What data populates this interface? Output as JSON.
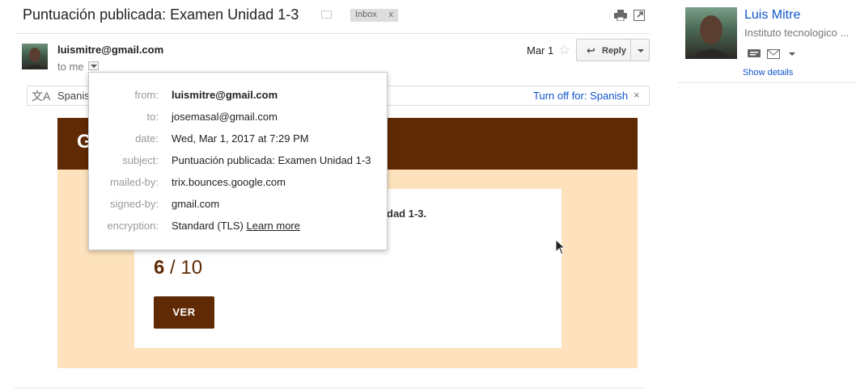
{
  "header": {
    "subject": "Puntuación publicada: Examen Unidad 1-3",
    "label_chip": "Inbox",
    "label_chip_close": "x"
  },
  "message": {
    "sender_email": "luismitre@gmail.com",
    "recipient_summary": "to me",
    "date": "Mar 1",
    "star_glyph": "☆",
    "reply_label": "Reply",
    "reply_arrow": "↩"
  },
  "translate_bar": {
    "icon_glyph": "文A",
    "language_partial": "Spanis",
    "turn_off_label": "Turn off for: Spanish",
    "close_glyph": "×"
  },
  "details_popup": {
    "rows": [
      {
        "label": "from:",
        "value": "luismitre@gmail.com",
        "bold": true
      },
      {
        "label": "to:",
        "value": "josemasal@gmail.com"
      },
      {
        "label": "date:",
        "value": "Wed, Mar 1, 2017 at 7:29 PM"
      },
      {
        "label": "subject:",
        "value": "Puntuación publicada: Examen Unidad 1-3"
      },
      {
        "label": "mailed-by:",
        "value": "trix.bounces.google.com"
      },
      {
        "label": "signed-by:",
        "value": "gmail.com"
      },
      {
        "label": "encryption:",
        "value": "Standard (TLS)",
        "link": "Learn more"
      }
    ]
  },
  "email_body": {
    "banner_letter": "G",
    "card_text_partial": "dad 1-3.",
    "score_value": "6",
    "score_total": " / 10",
    "button_label": "VER",
    "brand_color": "#5f2a04",
    "background_color": "#fde2bd"
  },
  "profile": {
    "name": "Luis Mitre",
    "organization": "Instituto tecnologico ...",
    "show_details": "Show details",
    "link_color": "#1155cc"
  }
}
